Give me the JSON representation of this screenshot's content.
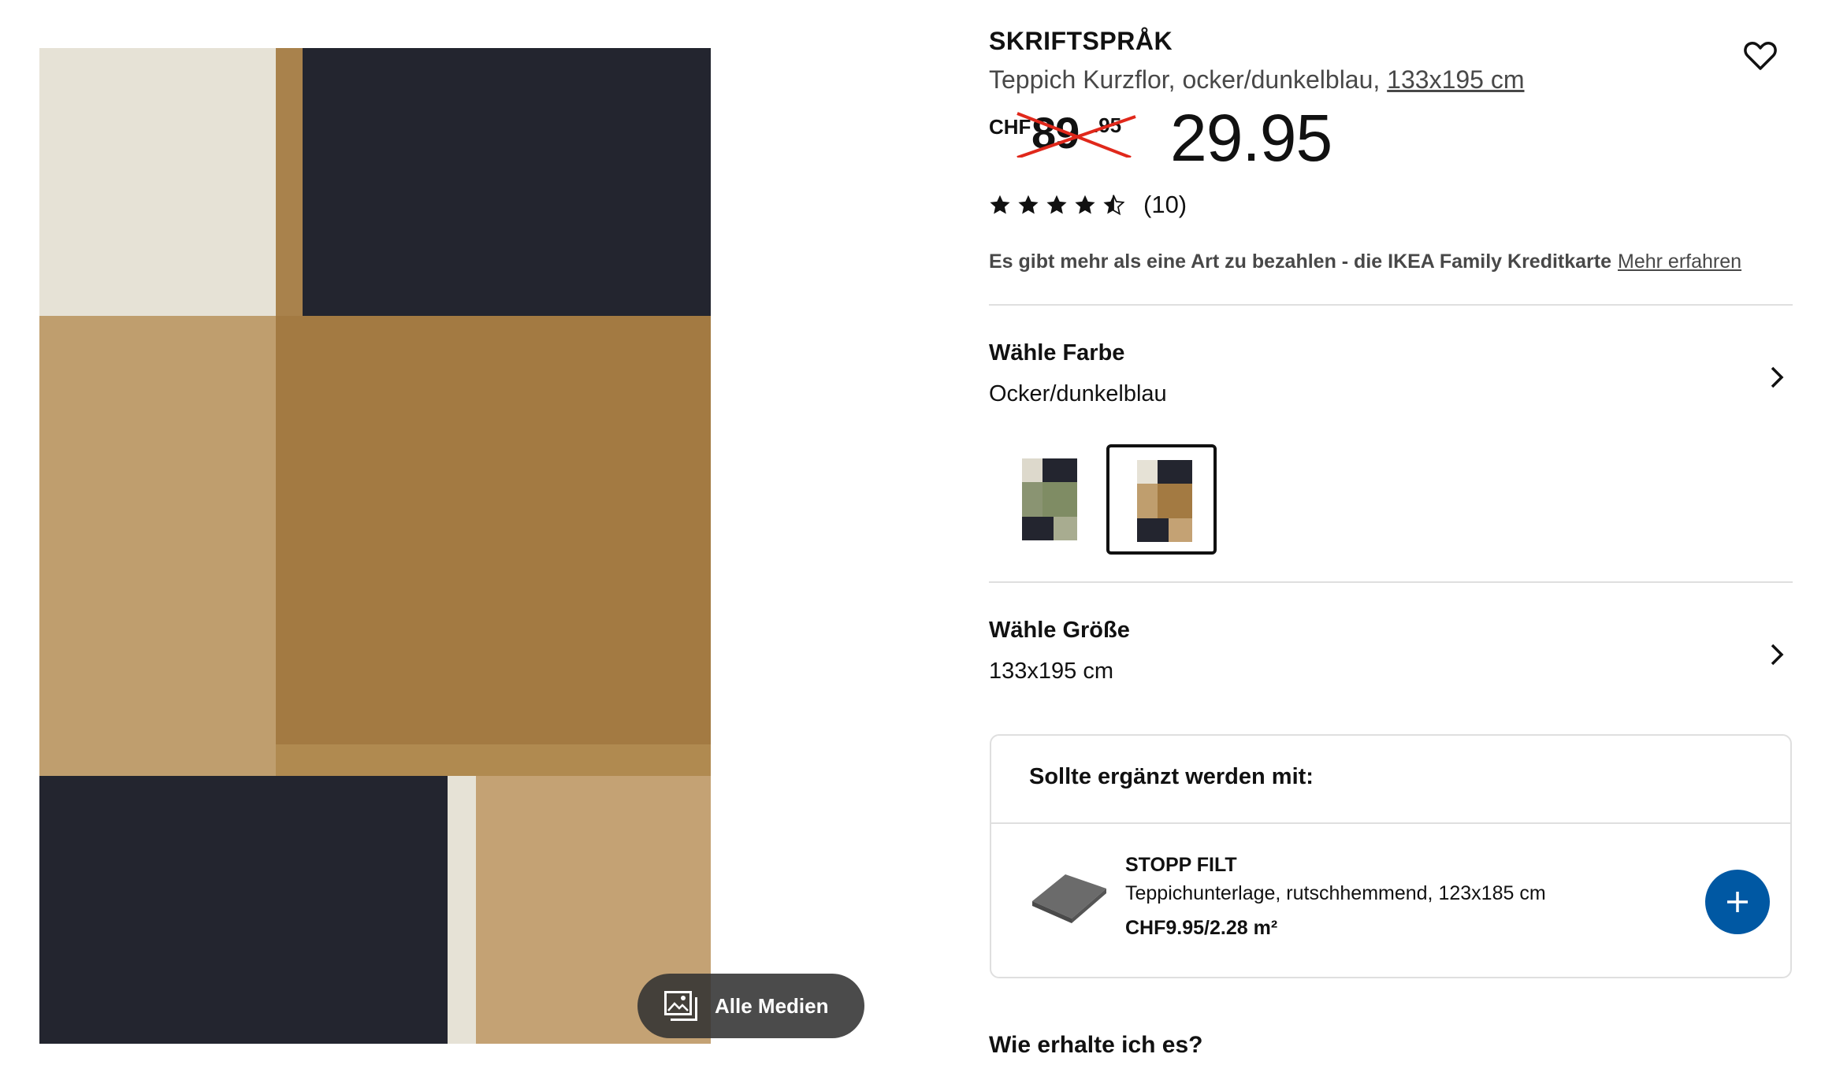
{
  "product": {
    "name": "SKRIFTSPRÅK",
    "subtitle_prefix": "Teppich Kurzflor, ocker/dunkelblau,",
    "subtitle_size": "133x195 cm"
  },
  "price": {
    "old_currency": "CHF",
    "old_integer": "89",
    "old_decimal": ".95",
    "new_price": "29.95"
  },
  "rating": {
    "value": 4.5,
    "max": 5,
    "count": "(10)"
  },
  "promo": {
    "text": "Es gibt mehr als eine Art zu bezahlen - die IKEA Family Kreditkarte",
    "link": "Mehr erfahren"
  },
  "color_section": {
    "title": "Wähle Farbe",
    "value": "Ocker/dunkelblau",
    "swatches": [
      {
        "name": "green",
        "selected": false
      },
      {
        "name": "ocker-dunkelblau",
        "selected": true
      }
    ]
  },
  "size_section": {
    "title": "Wähle Größe",
    "value": "133x195 cm"
  },
  "addon": {
    "heading": "Sollte ergänzt werden mit:",
    "product_name": "STOPP FILT",
    "product_desc": "Teppichunterlage, rutschhemmend, 123x185 cm",
    "product_price": "CHF9.95/2.28 m²"
  },
  "media_button": {
    "label": "Alle Medien"
  },
  "delivery": {
    "title": "Wie erhalte ich es?"
  },
  "colors": {
    "navy": "#23252f",
    "ocker": "#a9824c",
    "sand": "#bf9e6e",
    "cream": "#e8e4da",
    "strike_red": "#e0281b",
    "blue": "#0058a3"
  }
}
